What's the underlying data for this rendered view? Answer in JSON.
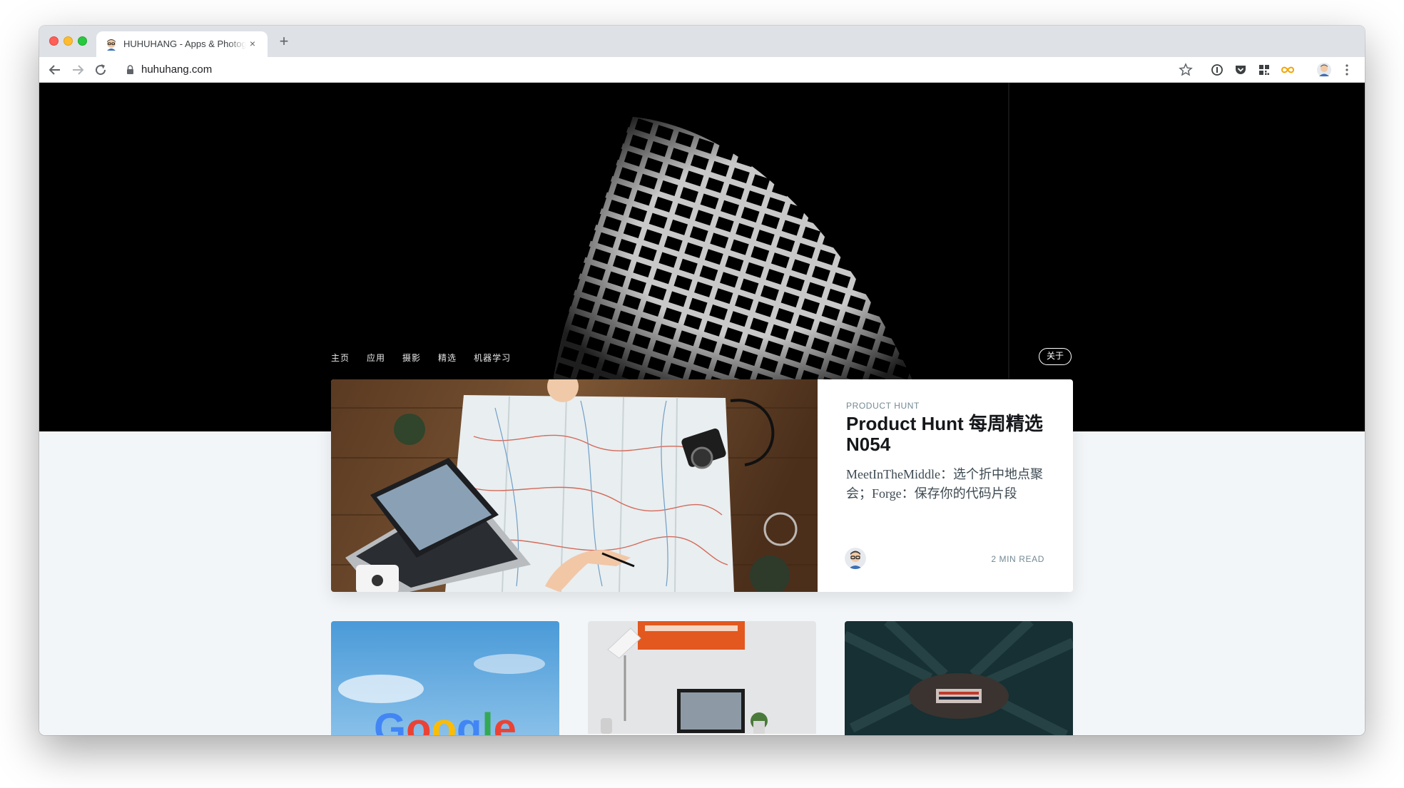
{
  "browser": {
    "tab_title": "HUHUHANG - Apps & Photography",
    "close_glyph": "×",
    "new_tab_glyph": "+",
    "url": "huhuhang.com"
  },
  "site": {
    "nav": [
      "主页",
      "应用",
      "摄影",
      "精选",
      "机器学习"
    ],
    "about_label": "关于"
  },
  "featured": {
    "tag": "PRODUCT HUNT",
    "title": "Product Hunt 每周精选 N054",
    "excerpt": "MeetInTheMiddle：选个折中地点聚会；Forge：保存你的代码片段",
    "read_time": "2 MIN READ"
  },
  "cards": [
    {
      "thumb_text": "Google"
    },
    {
      "thumb_text": ""
    },
    {
      "thumb_text": ""
    }
  ],
  "colors": {
    "accent_link": "#738a94",
    "hero_bg": "#000000",
    "page_bg": "#f3f6f9"
  }
}
